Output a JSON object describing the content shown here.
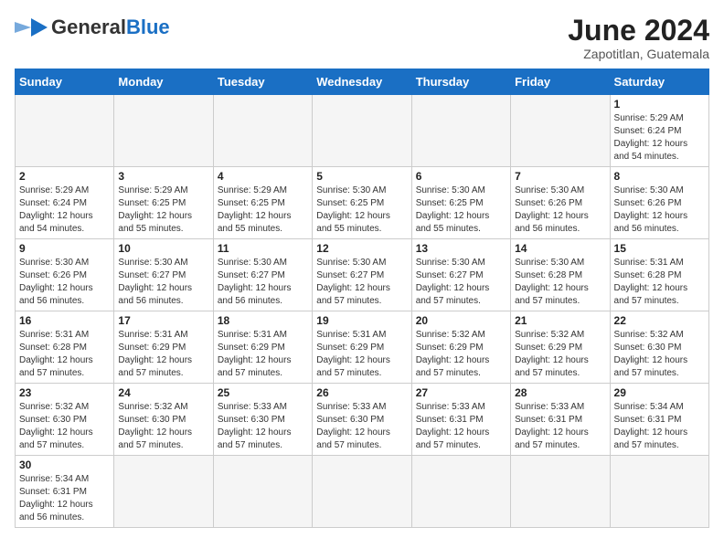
{
  "header": {
    "logo_general": "General",
    "logo_blue": "Blue",
    "month_year": "June 2024",
    "location": "Zapotitlan, Guatemala"
  },
  "days_of_week": [
    "Sunday",
    "Monday",
    "Tuesday",
    "Wednesday",
    "Thursday",
    "Friday",
    "Saturday"
  ],
  "weeks": [
    [
      {
        "day": "",
        "info": ""
      },
      {
        "day": "",
        "info": ""
      },
      {
        "day": "",
        "info": ""
      },
      {
        "day": "",
        "info": ""
      },
      {
        "day": "",
        "info": ""
      },
      {
        "day": "",
        "info": ""
      },
      {
        "day": "1",
        "info": "Sunrise: 5:29 AM\nSunset: 6:24 PM\nDaylight: 12 hours\nand 54 minutes."
      }
    ],
    [
      {
        "day": "2",
        "info": "Sunrise: 5:29 AM\nSunset: 6:24 PM\nDaylight: 12 hours\nand 54 minutes."
      },
      {
        "day": "3",
        "info": "Sunrise: 5:29 AM\nSunset: 6:25 PM\nDaylight: 12 hours\nand 55 minutes."
      },
      {
        "day": "4",
        "info": "Sunrise: 5:29 AM\nSunset: 6:25 PM\nDaylight: 12 hours\nand 55 minutes."
      },
      {
        "day": "5",
        "info": "Sunrise: 5:30 AM\nSunset: 6:25 PM\nDaylight: 12 hours\nand 55 minutes."
      },
      {
        "day": "6",
        "info": "Sunrise: 5:30 AM\nSunset: 6:25 PM\nDaylight: 12 hours\nand 55 minutes."
      },
      {
        "day": "7",
        "info": "Sunrise: 5:30 AM\nSunset: 6:26 PM\nDaylight: 12 hours\nand 56 minutes."
      },
      {
        "day": "8",
        "info": "Sunrise: 5:30 AM\nSunset: 6:26 PM\nDaylight: 12 hours\nand 56 minutes."
      }
    ],
    [
      {
        "day": "9",
        "info": "Sunrise: 5:30 AM\nSunset: 6:26 PM\nDaylight: 12 hours\nand 56 minutes."
      },
      {
        "day": "10",
        "info": "Sunrise: 5:30 AM\nSunset: 6:27 PM\nDaylight: 12 hours\nand 56 minutes."
      },
      {
        "day": "11",
        "info": "Sunrise: 5:30 AM\nSunset: 6:27 PM\nDaylight: 12 hours\nand 56 minutes."
      },
      {
        "day": "12",
        "info": "Sunrise: 5:30 AM\nSunset: 6:27 PM\nDaylight: 12 hours\nand 57 minutes."
      },
      {
        "day": "13",
        "info": "Sunrise: 5:30 AM\nSunset: 6:27 PM\nDaylight: 12 hours\nand 57 minutes."
      },
      {
        "day": "14",
        "info": "Sunrise: 5:30 AM\nSunset: 6:28 PM\nDaylight: 12 hours\nand 57 minutes."
      },
      {
        "day": "15",
        "info": "Sunrise: 5:31 AM\nSunset: 6:28 PM\nDaylight: 12 hours\nand 57 minutes."
      }
    ],
    [
      {
        "day": "16",
        "info": "Sunrise: 5:31 AM\nSunset: 6:28 PM\nDaylight: 12 hours\nand 57 minutes."
      },
      {
        "day": "17",
        "info": "Sunrise: 5:31 AM\nSunset: 6:29 PM\nDaylight: 12 hours\nand 57 minutes."
      },
      {
        "day": "18",
        "info": "Sunrise: 5:31 AM\nSunset: 6:29 PM\nDaylight: 12 hours\nand 57 minutes."
      },
      {
        "day": "19",
        "info": "Sunrise: 5:31 AM\nSunset: 6:29 PM\nDaylight: 12 hours\nand 57 minutes."
      },
      {
        "day": "20",
        "info": "Sunrise: 5:32 AM\nSunset: 6:29 PM\nDaylight: 12 hours\nand 57 minutes."
      },
      {
        "day": "21",
        "info": "Sunrise: 5:32 AM\nSunset: 6:29 PM\nDaylight: 12 hours\nand 57 minutes."
      },
      {
        "day": "22",
        "info": "Sunrise: 5:32 AM\nSunset: 6:30 PM\nDaylight: 12 hours\nand 57 minutes."
      }
    ],
    [
      {
        "day": "23",
        "info": "Sunrise: 5:32 AM\nSunset: 6:30 PM\nDaylight: 12 hours\nand 57 minutes."
      },
      {
        "day": "24",
        "info": "Sunrise: 5:32 AM\nSunset: 6:30 PM\nDaylight: 12 hours\nand 57 minutes."
      },
      {
        "day": "25",
        "info": "Sunrise: 5:33 AM\nSunset: 6:30 PM\nDaylight: 12 hours\nand 57 minutes."
      },
      {
        "day": "26",
        "info": "Sunrise: 5:33 AM\nSunset: 6:30 PM\nDaylight: 12 hours\nand 57 minutes."
      },
      {
        "day": "27",
        "info": "Sunrise: 5:33 AM\nSunset: 6:31 PM\nDaylight: 12 hours\nand 57 minutes."
      },
      {
        "day": "28",
        "info": "Sunrise: 5:33 AM\nSunset: 6:31 PM\nDaylight: 12 hours\nand 57 minutes."
      },
      {
        "day": "29",
        "info": "Sunrise: 5:34 AM\nSunset: 6:31 PM\nDaylight: 12 hours\nand 57 minutes."
      }
    ],
    [
      {
        "day": "30",
        "info": "Sunrise: 5:34 AM\nSunset: 6:31 PM\nDaylight: 12 hours\nand 56 minutes."
      },
      {
        "day": "",
        "info": ""
      },
      {
        "day": "",
        "info": ""
      },
      {
        "day": "",
        "info": ""
      },
      {
        "day": "",
        "info": ""
      },
      {
        "day": "",
        "info": ""
      },
      {
        "day": "",
        "info": ""
      }
    ]
  ]
}
